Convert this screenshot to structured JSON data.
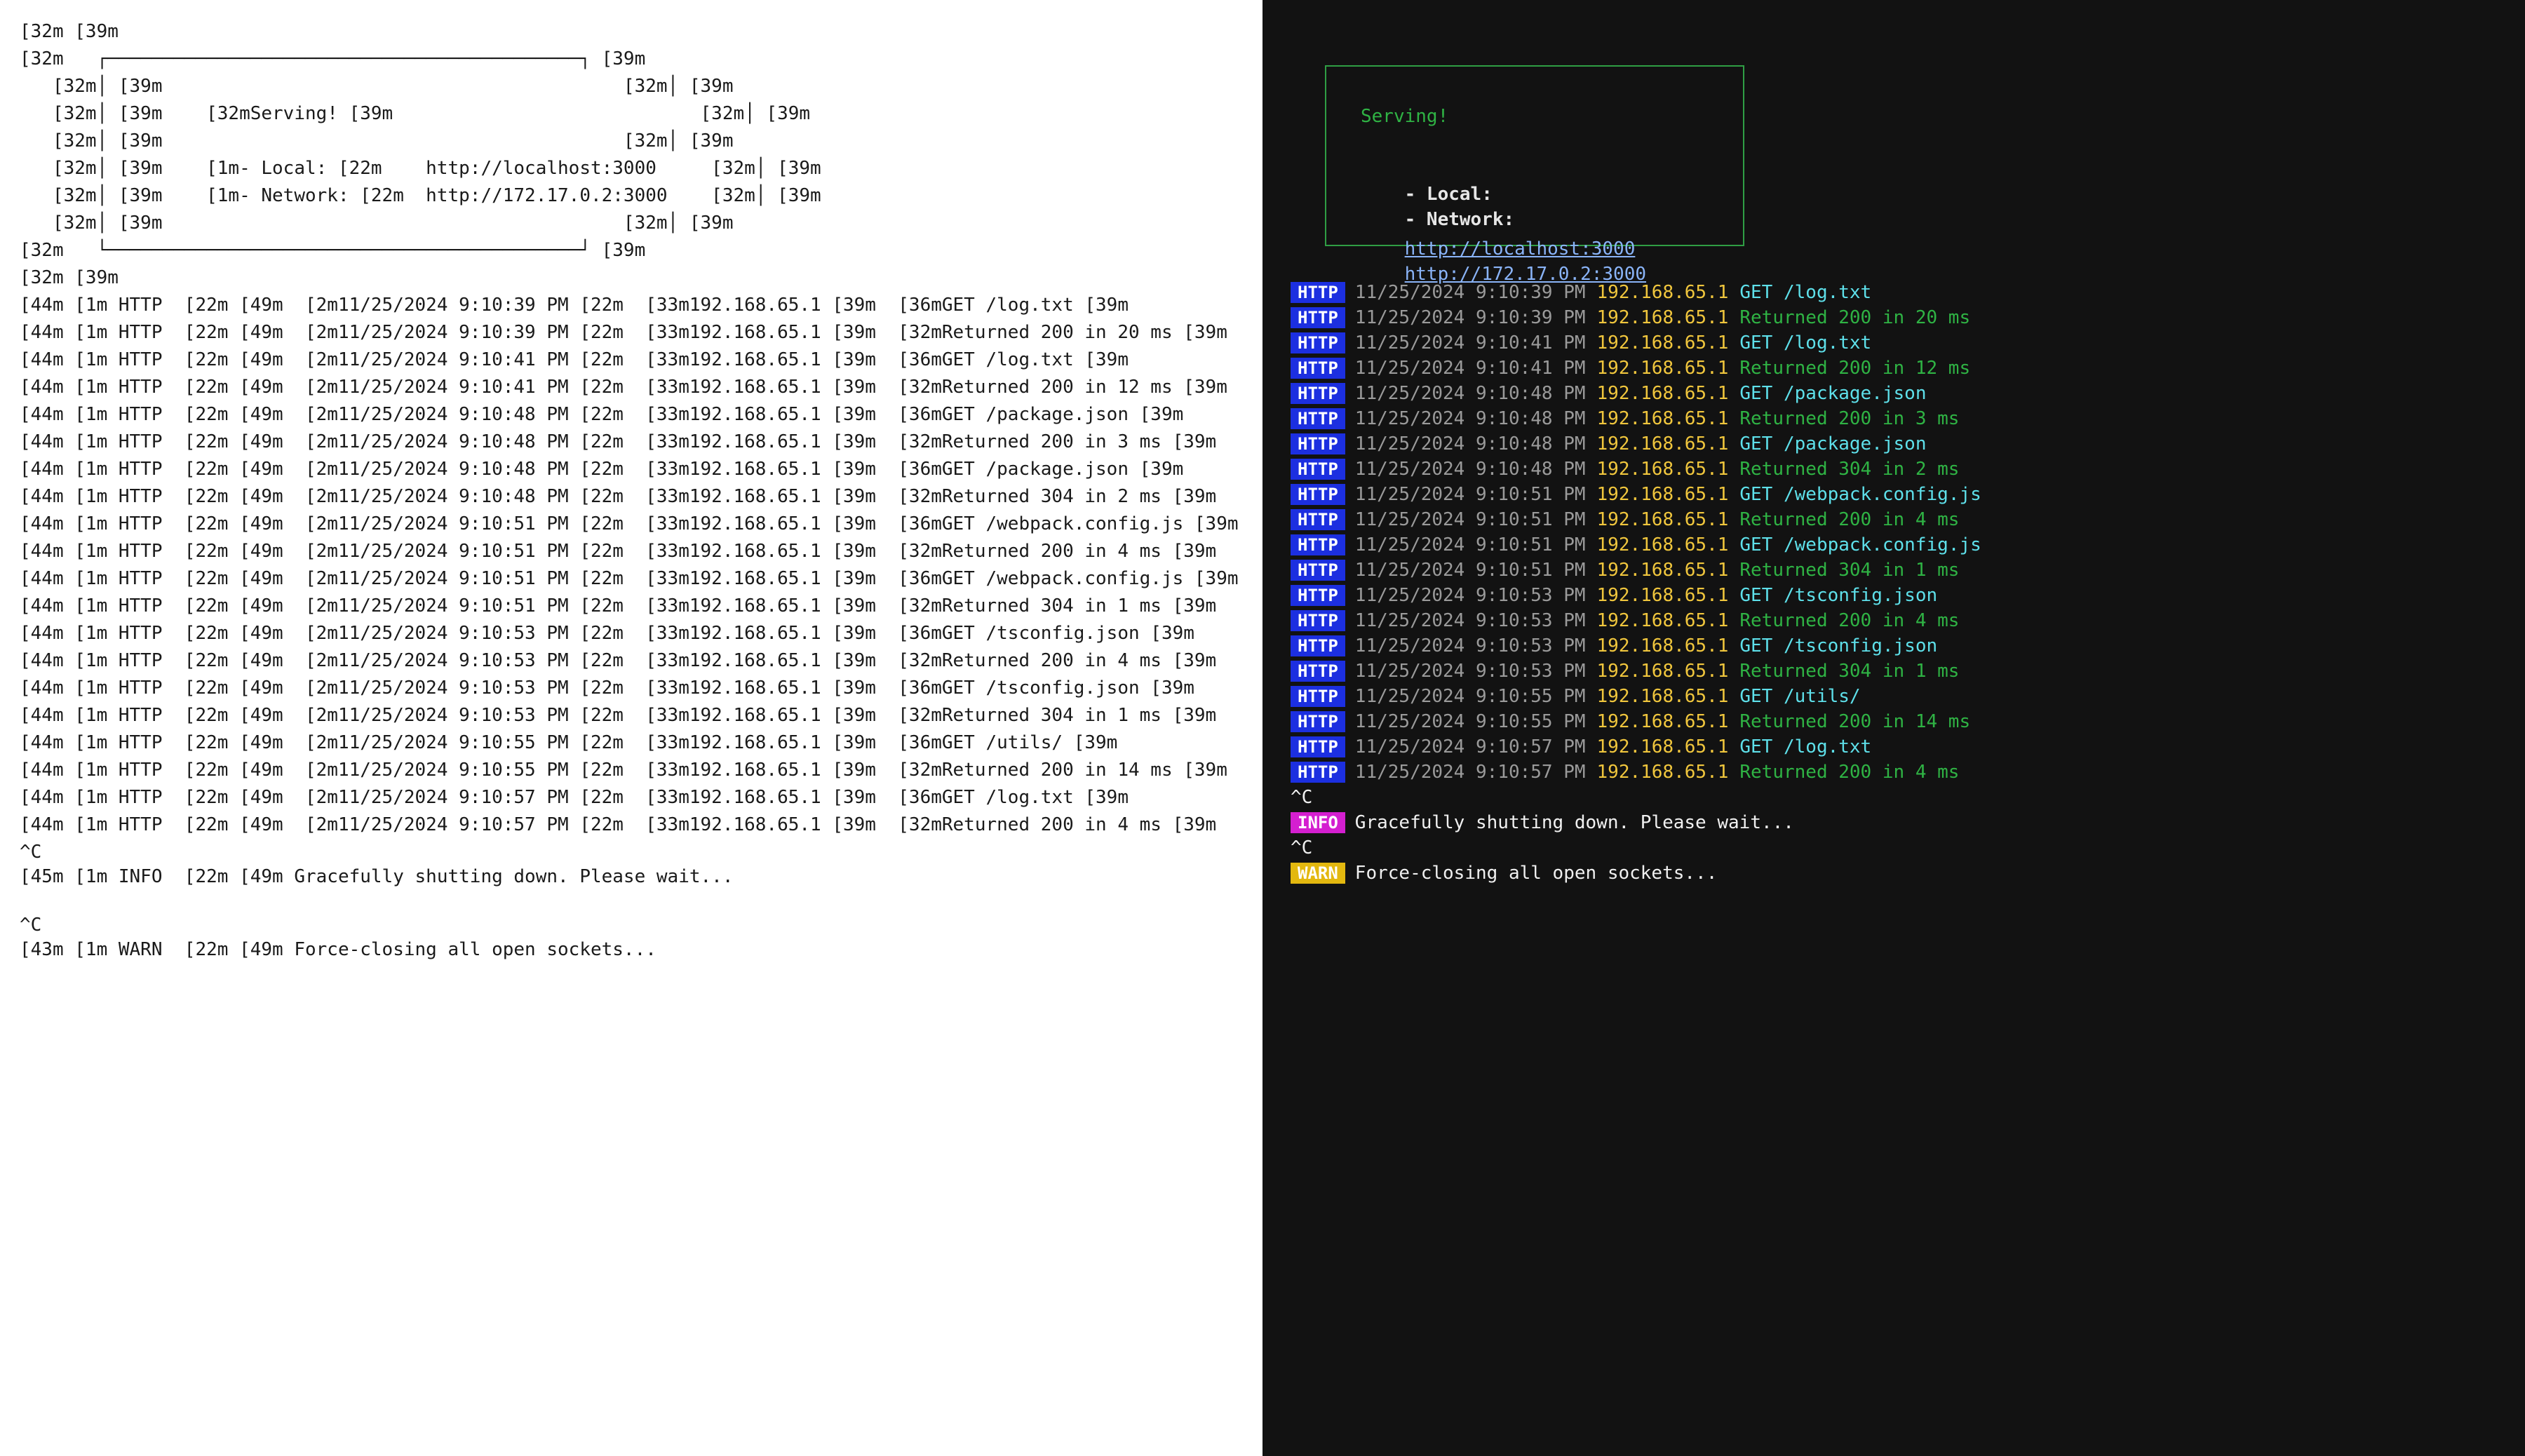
{
  "left_pane": {
    "header_lines": [
      "[32m [39m",
      "[32m   ┌───────────────────────────────────────────┐ [39m",
      "   [32m│ [39m                                          [32m│ [39m",
      "   [32m│ [39m    [32mServing! [39m                            [32m│ [39m",
      "   [32m│ [39m                                          [32m│ [39m",
      "   [32m│ [39m    [1m- Local: [22m    http://localhost:3000     [32m│ [39m",
      "   [32m│ [39m    [1m- Network: [22m  http://172.17.0.2:3000    [32m│ [39m",
      "   [32m│ [39m                                          [32m│ [39m",
      "[32m   └───────────────────────────────────────────┘ [39m",
      "[32m [39m"
    ],
    "log_lines": [
      "[44m [1m HTTP  [22m [49m  [2m11/25/2024 9:10:39 PM [22m  [33m192.168.65.1 [39m  [36mGET /log.txt [39m",
      "[44m [1m HTTP  [22m [49m  [2m11/25/2024 9:10:39 PM [22m  [33m192.168.65.1 [39m  [32mReturned 200 in 20 ms [39m",
      "[44m [1m HTTP  [22m [49m  [2m11/25/2024 9:10:41 PM [22m  [33m192.168.65.1 [39m  [36mGET /log.txt [39m",
      "[44m [1m HTTP  [22m [49m  [2m11/25/2024 9:10:41 PM [22m  [33m192.168.65.1 [39m  [32mReturned 200 in 12 ms [39m",
      "[44m [1m HTTP  [22m [49m  [2m11/25/2024 9:10:48 PM [22m  [33m192.168.65.1 [39m  [36mGET /package.json [39m",
      "[44m [1m HTTP  [22m [49m  [2m11/25/2024 9:10:48 PM [22m  [33m192.168.65.1 [39m  [32mReturned 200 in 3 ms [39m",
      "[44m [1m HTTP  [22m [49m  [2m11/25/2024 9:10:48 PM [22m  [33m192.168.65.1 [39m  [36mGET /package.json [39m",
      "[44m [1m HTTP  [22m [49m  [2m11/25/2024 9:10:48 PM [22m  [33m192.168.65.1 [39m  [32mReturned 304 in 2 ms [39m",
      "[44m [1m HTTP  [22m [49m  [2m11/25/2024 9:10:51 PM [22m  [33m192.168.65.1 [39m  [36mGET /webpack.config.js [39m",
      "[44m [1m HTTP  [22m [49m  [2m11/25/2024 9:10:51 PM [22m  [33m192.168.65.1 [39m  [32mReturned 200 in 4 ms [39m",
      "[44m [1m HTTP  [22m [49m  [2m11/25/2024 9:10:51 PM [22m  [33m192.168.65.1 [39m  [36mGET /webpack.config.js [39m",
      "[44m [1m HTTP  [22m [49m  [2m11/25/2024 9:10:51 PM [22m  [33m192.168.65.1 [39m  [32mReturned 304 in 1 ms [39m",
      "[44m [1m HTTP  [22m [49m  [2m11/25/2024 9:10:53 PM [22m  [33m192.168.65.1 [39m  [36mGET /tsconfig.json [39m",
      "[44m [1m HTTP  [22m [49m  [2m11/25/2024 9:10:53 PM [22m  [33m192.168.65.1 [39m  [32mReturned 200 in 4 ms [39m",
      "[44m [1m HTTP  [22m [49m  [2m11/25/2024 9:10:53 PM [22m  [33m192.168.65.1 [39m  [36mGET /tsconfig.json [39m",
      "[44m [1m HTTP  [22m [49m  [2m11/25/2024 9:10:53 PM [22m  [33m192.168.65.1 [39m  [32mReturned 304 in 1 ms [39m",
      "[44m [1m HTTP  [22m [49m  [2m11/25/2024 9:10:55 PM [22m  [33m192.168.65.1 [39m  [36mGET /utils/ [39m",
      "[44m [1m HTTP  [22m [49m  [2m11/25/2024 9:10:55 PM [22m  [33m192.168.65.1 [39m  [32mReturned 200 in 14 ms [39m",
      "[44m [1m HTTP  [22m [49m  [2m11/25/2024 9:10:57 PM [22m  [33m192.168.65.1 [39m  [36mGET /log.txt [39m",
      "[44m [1m HTTP  [22m [49m  [2m11/25/2024 9:10:57 PM [22m  [33m192.168.65.1 [39m  [32mReturned 200 in 4 ms [39m"
    ],
    "tail_lines": [
      "^C",
      "[45m [1m INFO  [22m [49m Gracefully shutting down. Please wait...",
      "^C",
      "[43m [1m WARN  [22m [49m Force-closing all open sockets..."
    ]
  },
  "right_pane": {
    "box": {
      "serving": "Serving!",
      "local_label": "- Local:",
      "local_url": "http://localhost:3000",
      "network_label": "- Network:",
      "network_url": "http://172.17.0.2:3000"
    },
    "log_entries": [
      {
        "badge": "HTTP",
        "time": "11/25/2024 9:10:39 PM",
        "ip": "192.168.65.1",
        "msg": "GET /log.txt",
        "kind": "get"
      },
      {
        "badge": "HTTP",
        "time": "11/25/2024 9:10:39 PM",
        "ip": "192.168.65.1",
        "msg": "Returned 200 in 20 ms",
        "kind": "ret"
      },
      {
        "badge": "HTTP",
        "time": "11/25/2024 9:10:41 PM",
        "ip": "192.168.65.1",
        "msg": "GET /log.txt",
        "kind": "get"
      },
      {
        "badge": "HTTP",
        "time": "11/25/2024 9:10:41 PM",
        "ip": "192.168.65.1",
        "msg": "Returned 200 in 12 ms",
        "kind": "ret"
      },
      {
        "badge": "HTTP",
        "time": "11/25/2024 9:10:48 PM",
        "ip": "192.168.65.1",
        "msg": "GET /package.json",
        "kind": "get"
      },
      {
        "badge": "HTTP",
        "time": "11/25/2024 9:10:48 PM",
        "ip": "192.168.65.1",
        "msg": "Returned 200 in 3 ms",
        "kind": "ret"
      },
      {
        "badge": "HTTP",
        "time": "11/25/2024 9:10:48 PM",
        "ip": "192.168.65.1",
        "msg": "GET /package.json",
        "kind": "get"
      },
      {
        "badge": "HTTP",
        "time": "11/25/2024 9:10:48 PM",
        "ip": "192.168.65.1",
        "msg": "Returned 304 in 2 ms",
        "kind": "ret"
      },
      {
        "badge": "HTTP",
        "time": "11/25/2024 9:10:51 PM",
        "ip": "192.168.65.1",
        "msg": "GET /webpack.config.js",
        "kind": "get"
      },
      {
        "badge": "HTTP",
        "time": "11/25/2024 9:10:51 PM",
        "ip": "192.168.65.1",
        "msg": "Returned 200 in 4 ms",
        "kind": "ret"
      },
      {
        "badge": "HTTP",
        "time": "11/25/2024 9:10:51 PM",
        "ip": "192.168.65.1",
        "msg": "GET /webpack.config.js",
        "kind": "get"
      },
      {
        "badge": "HTTP",
        "time": "11/25/2024 9:10:51 PM",
        "ip": "192.168.65.1",
        "msg": "Returned 304 in 1 ms",
        "kind": "ret"
      },
      {
        "badge": "HTTP",
        "time": "11/25/2024 9:10:53 PM",
        "ip": "192.168.65.1",
        "msg": "GET /tsconfig.json",
        "kind": "get"
      },
      {
        "badge": "HTTP",
        "time": "11/25/2024 9:10:53 PM",
        "ip": "192.168.65.1",
        "msg": "Returned 200 in 4 ms",
        "kind": "ret"
      },
      {
        "badge": "HTTP",
        "time": "11/25/2024 9:10:53 PM",
        "ip": "192.168.65.1",
        "msg": "GET /tsconfig.json",
        "kind": "get"
      },
      {
        "badge": "HTTP",
        "time": "11/25/2024 9:10:53 PM",
        "ip": "192.168.65.1",
        "msg": "Returned 304 in 1 ms",
        "kind": "ret"
      },
      {
        "badge": "HTTP",
        "time": "11/25/2024 9:10:55 PM",
        "ip": "192.168.65.1",
        "msg": "GET /utils/",
        "kind": "get"
      },
      {
        "badge": "HTTP",
        "time": "11/25/2024 9:10:55 PM",
        "ip": "192.168.65.1",
        "msg": "Returned 200 in 14 ms",
        "kind": "ret"
      },
      {
        "badge": "HTTP",
        "time": "11/25/2024 9:10:57 PM",
        "ip": "192.168.65.1",
        "msg": "GET /log.txt",
        "kind": "get"
      },
      {
        "badge": "HTTP",
        "time": "11/25/2024 9:10:57 PM",
        "ip": "192.168.65.1",
        "msg": "Returned 200 in 4 ms",
        "kind": "ret"
      }
    ],
    "tail": [
      {
        "type": "plain",
        "text": "^C"
      },
      {
        "type": "badge",
        "badge": "INFO",
        "text": "Gracefully shutting down. Please wait..."
      },
      {
        "type": "plain",
        "text": "^C"
      },
      {
        "type": "badge",
        "badge": "WARN",
        "text": "Force-closing all open sockets..."
      }
    ]
  },
  "colors": {
    "http_badge": "#1c2fe0",
    "info_badge": "#d41fd0",
    "warn_badge": "#e3b80f",
    "ip": "#f0c63d",
    "get": "#5ee0ea",
    "returned": "#2fb344",
    "box": "#2f9e44",
    "link": "#8ab4f8"
  }
}
